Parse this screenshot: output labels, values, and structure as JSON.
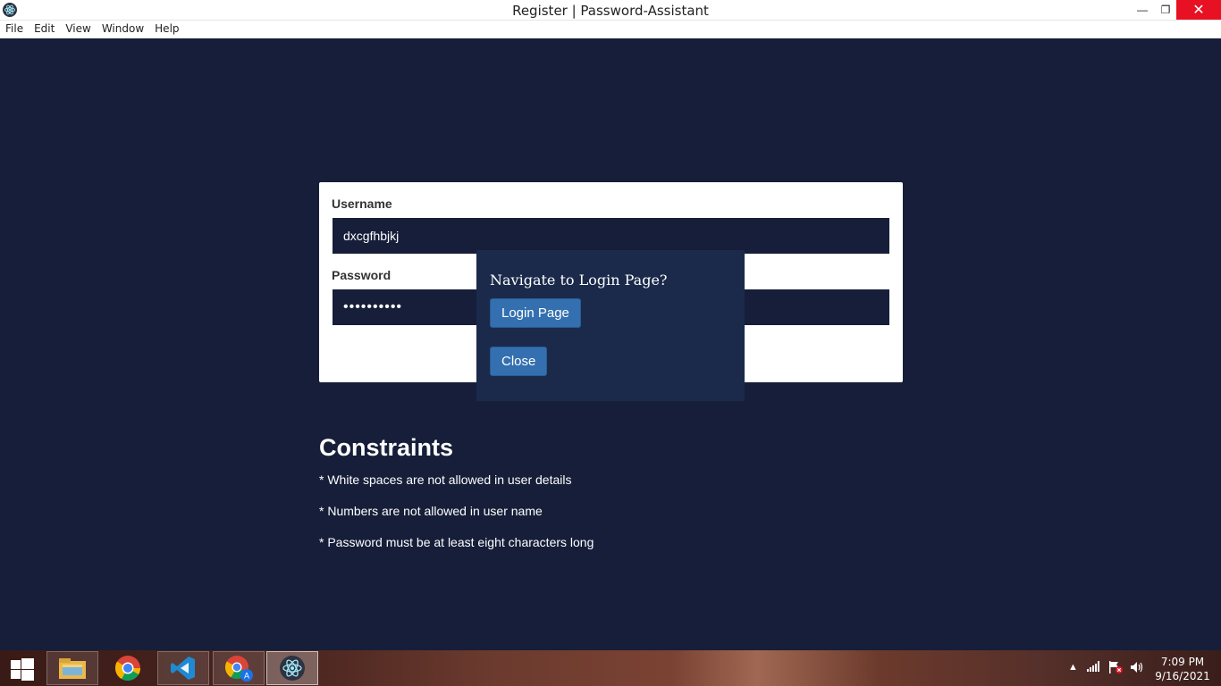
{
  "window": {
    "title": "Register | Password-Assistant",
    "minimize_glyph": "—",
    "maximize_glyph": "❐",
    "close_glyph": "✕"
  },
  "menu": [
    "File",
    "Edit",
    "View",
    "Window",
    "Help"
  ],
  "form": {
    "username_label": "Username",
    "username_value": "dxcgfhbjkj",
    "password_label": "Password",
    "password_value": "••••••••••"
  },
  "modal": {
    "title": "Navigate to Login Page?",
    "login_button": "Login Page",
    "close_button": "Close"
  },
  "constraints": {
    "title": "Constraints",
    "items": [
      "* White spaces are not allowed in user details",
      "* Numbers are not allowed in user name",
      "* Password must be at least eight characters long"
    ]
  },
  "taskbar": {
    "apps": [
      "file-explorer-icon",
      "chrome-icon",
      "vscode-icon",
      "chrome-profile-icon",
      "electron-icon"
    ],
    "time": "7:09 PM",
    "date": "9/16/2021"
  },
  "colors": {
    "background": "#161e39",
    "modal": "#1b2a4b",
    "button": "#3470b0",
    "close_hover": "#e81123"
  }
}
